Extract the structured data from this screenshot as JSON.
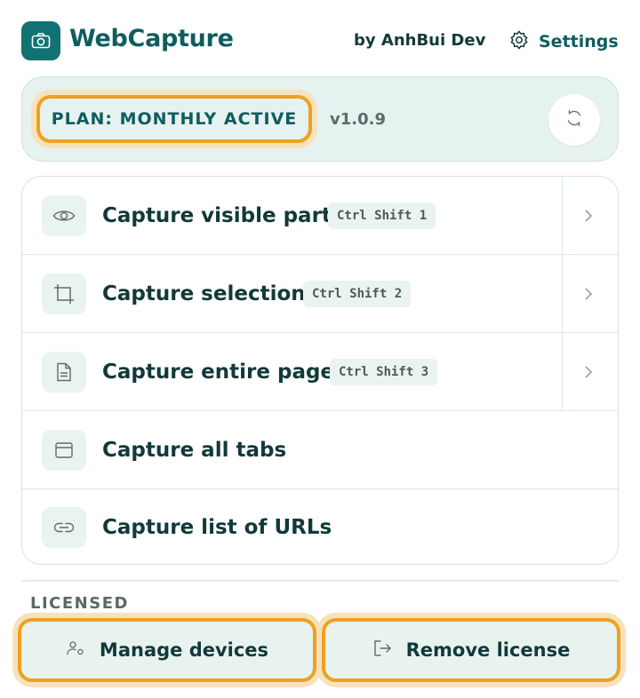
{
  "header": {
    "app_title": "WebCapture",
    "author": "by AnhBui Dev",
    "settings_label": "Settings"
  },
  "plan": {
    "badge": "PLAN: MONTHLY ACTIVE",
    "version": "v1.0.9"
  },
  "actions": [
    {
      "label": "Capture visible part",
      "shortcut": "Ctrl Shift 1",
      "icon": "eye-icon"
    },
    {
      "label": "Capture selection",
      "shortcut": "Ctrl Shift 2",
      "icon": "crop-icon"
    },
    {
      "label": "Capture entire page",
      "shortcut": "Ctrl Shift 3",
      "icon": "document-icon"
    },
    {
      "label": "Capture all tabs",
      "icon": "window-icon"
    },
    {
      "label": "Capture list of URLs",
      "icon": "link-icon"
    }
  ],
  "license": {
    "section_label": "LICENSED",
    "manage_label": "Manage devices",
    "remove_label": "Remove license"
  },
  "colors": {
    "accent": "#0f5d60",
    "highlight": "#f0a11f",
    "card_bg": "#e6f2ef"
  }
}
